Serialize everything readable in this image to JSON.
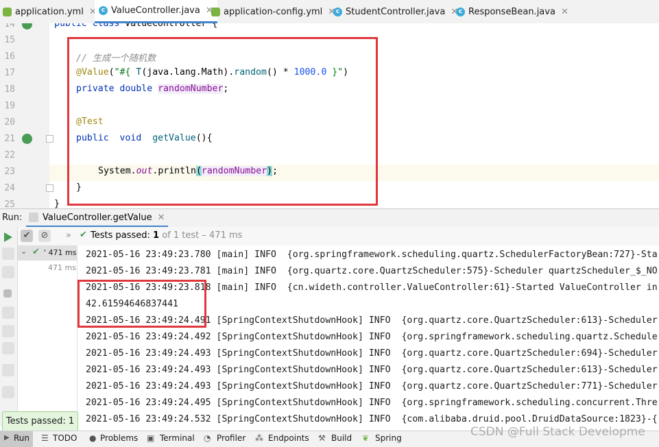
{
  "tabs": [
    {
      "label": "application.yml",
      "icon": "yml-file-icon",
      "active": false
    },
    {
      "label": "ValueController.java",
      "icon": "class-file-icon",
      "active": true
    },
    {
      "label": "application-config.yml",
      "icon": "yml-file-icon",
      "active": false
    },
    {
      "label": "StudentController.java",
      "icon": "class-file-icon",
      "active": false
    },
    {
      "label": "ResponseBean.java",
      "icon": "class-file-icon",
      "active": false
    }
  ],
  "tab_close_glyph": "✕",
  "editor": {
    "line_numbers": [
      "14",
      "15",
      "16",
      "17",
      "18",
      "19",
      "20",
      "21",
      "22",
      "23",
      "24",
      "25"
    ],
    "line14": {
      "kw1": "public",
      "kw2": "class",
      "name": "ValueController {"
    },
    "line16": {
      "comment": "// 生成一个随机数"
    },
    "line17": {
      "annotation": "@Value",
      "p1": "(",
      "s1": "\"#{ ",
      "type": "T",
      "p2": "(java.lang.Math).",
      "call": "random",
      "p3": "() * ",
      "num": "1000.0",
      "s2": " }\"",
      "p4": ")"
    },
    "line18": {
      "kw1": "private",
      "kw2": "double",
      "field": "randomNumber",
      "end": ";"
    },
    "line20": {
      "annotation": "@Test"
    },
    "line21": {
      "kw1": "public",
      "kw2": "void",
      "method": "getValue",
      "end": "(){"
    },
    "line23": {
      "prefix": "System.",
      "static_field": "out",
      "call": ".println",
      "p1": "(",
      "field": "randomNumber",
      "p2": ")",
      "end": ";"
    },
    "line24": {
      "text": "}"
    },
    "line25": {
      "text": "}"
    }
  },
  "run_bar": {
    "label": "Run:",
    "config_name": "ValueController.getValue",
    "close_glyph": "✕"
  },
  "results_bar": {
    "expand_glyph": "»",
    "status": "Tests passed:",
    "passed_count": "1",
    "summary": "of 1 test – 471 ms"
  },
  "tree": {
    "root_time": "' 471 ms",
    "child_time": "471 ms"
  },
  "console_lines": [
    "2021-05-16 23:49:23.780 [main] INFO  {org.springframework.scheduling.quartz.SchedulerFactoryBean:727}-Sta",
    "2021-05-16 23:49:23.781 [main] INFO  {org.quartz.core.QuartzScheduler:575}-Scheduler quartzScheduler_$_NO",
    "2021-05-16 23:49:23.818 [main] INFO  {cn.wideth.controller.ValueController:61}-Started ValueController in",
    "42.61594646837441",
    "2021-05-16 23:49:24.491 [SpringContextShutdownHook] INFO  {org.quartz.core.QuartzScheduler:613}-Scheduler",
    "2021-05-16 23:49:24.492 [SpringContextShutdownHook] INFO  {org.springframework.scheduling.quartz.Schedule",
    "2021-05-16 23:49:24.493 [SpringContextShutdownHook] INFO  {org.quartz.core.QuartzScheduler:694}-Scheduler",
    "2021-05-16 23:49:24.493 [SpringContextShutdownHook] INFO  {org.quartz.core.QuartzScheduler:613}-Scheduler",
    "2021-05-16 23:49:24.493 [SpringContextShutdownHook] INFO  {org.quartz.core.QuartzScheduler:771}-Scheduler",
    "2021-05-16 23:49:24.495 [SpringContextShutdownHook] INFO  {org.springframework.scheduling.concurrent.Thre",
    "2021-05-16 23:49:24.532 [SpringContextShutdownHook] INFO  {com.alibaba.druid.pool.DruidDataSource:1823}-{"
  ],
  "toast": "Tests passed: 1",
  "bottom_tools": [
    {
      "label": "Run",
      "icon": "run-icon"
    },
    {
      "label": "TODO",
      "icon": "list-icon"
    },
    {
      "label": "Problems",
      "icon": "problems-icon"
    },
    {
      "label": "Terminal",
      "icon": "terminal-icon"
    },
    {
      "label": "Profiler",
      "icon": "profiler-icon"
    },
    {
      "label": "Endpoints",
      "icon": "endpoints-icon"
    },
    {
      "label": "Build",
      "icon": "hammer-icon"
    },
    {
      "label": "Spring",
      "icon": "spring-leaf-icon"
    }
  ],
  "watermark": "CSDN @Full Stack Developme",
  "colors": {
    "accent": "#4083c9",
    "pass_green": "#499c54",
    "highlight_box": "#e0373c"
  }
}
